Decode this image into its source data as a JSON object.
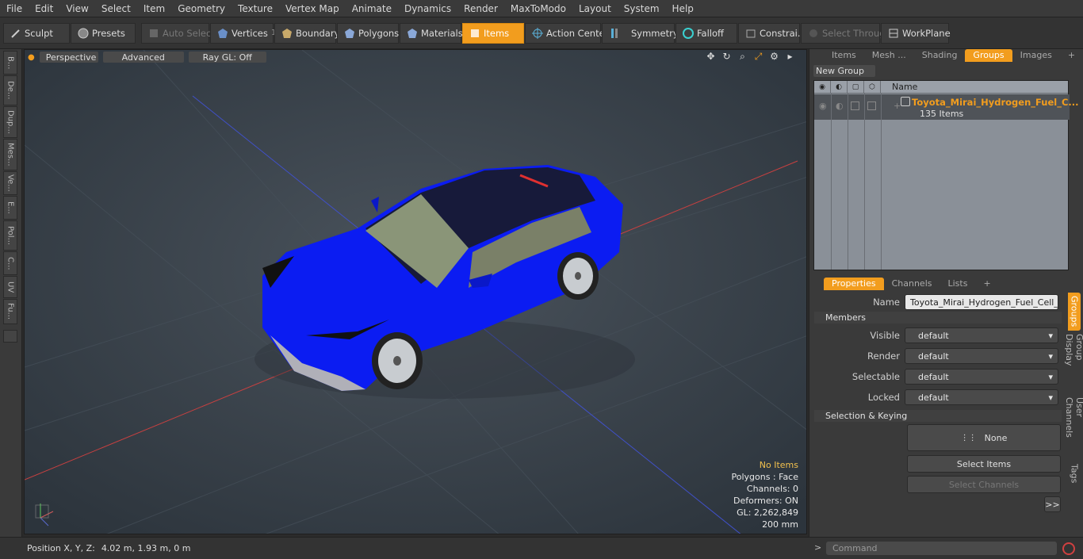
{
  "menu": [
    "File",
    "Edit",
    "View",
    "Select",
    "Item",
    "Geometry",
    "Texture",
    "Vertex Map",
    "Animate",
    "Dynamics",
    "Render",
    "MaxToModo",
    "Layout",
    "System",
    "Help"
  ],
  "toolbar": {
    "sculpt": "Sculpt",
    "presets": "Presets",
    "auto_select": "Auto Select",
    "vertices": "Vertices",
    "vertices_count": "1",
    "boundary": "Boundary",
    "polygons": "Polygons",
    "materials": "Materials",
    "items": "Items",
    "action_center": "Action Center",
    "symmetry": "Symmetry",
    "falloff": "Falloff",
    "constraints": "Constrai...",
    "select_through": "Select Through",
    "workplane": "WorkPlane"
  },
  "left_tabs": [
    "B...",
    "De...",
    "Dup...",
    "Mes...",
    "Ve...",
    "E...",
    "Pol...",
    "C...",
    "UV",
    "Fu..."
  ],
  "viewport": {
    "perspective": "Perspective",
    "advanced": "Advanced",
    "raygl": "Ray GL: Off",
    "stats": {
      "items": "No Items",
      "polygons": "Polygons : Face",
      "channels": "Channels: 0",
      "deformers": "Deformers: ON",
      "gl": "GL: 2,262,849",
      "scale": "200 mm"
    }
  },
  "status": {
    "position_label": "Position X, Y, Z:",
    "position_value": "4.02 m, 1.93 m, 0 m"
  },
  "right_panel": {
    "top_tabs": [
      "Items",
      "Mesh ...",
      "Shading",
      "Groups",
      "Images"
    ],
    "active_top_tab": "Groups",
    "new_group": "New Group",
    "name_col": "Name",
    "group_name": "Toyota_Mirai_Hydrogen_Fuel_C...",
    "group_count": "135 Items",
    "prop_tabs": [
      "Properties",
      "Channels",
      "Lists"
    ],
    "name_label": "Name",
    "name_value": "Toyota_Mirai_Hydrogen_Fuel_Cell_Vel",
    "members_label": "Members",
    "visible_label": "Visible",
    "render_label": "Render",
    "selectable_label": "Selectable",
    "locked_label": "Locked",
    "default_value": "default",
    "selection_keying": "Selection & Keying",
    "none": "None",
    "select_items": "Select Items",
    "select_channels": "Select Channels",
    "more": ">>",
    "side_tabs": [
      "Groups",
      "Group Display",
      "User Channels",
      "Tags"
    ]
  },
  "command": {
    "prompt": ">",
    "placeholder": "Command"
  }
}
